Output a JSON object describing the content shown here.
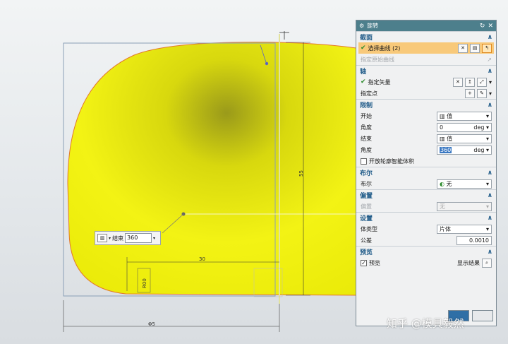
{
  "dialog": {
    "title": "旋转",
    "section_profile": {
      "title": "截面",
      "select_curve": "选择曲线 (2)",
      "specify_origin_curve": "指定原始曲线"
    },
    "section_axis": {
      "title": "轴",
      "specify_vector": "指定矢量",
      "specify_point": "指定点"
    },
    "section_limits": {
      "title": "限制",
      "start_label": "开始",
      "start_value": "值",
      "angle1_label": "角度",
      "angle1_value": "0",
      "angle1_unit": "deg",
      "end_label": "结束",
      "end_value": "值",
      "angle2_label": "角度",
      "angle2_value": "360",
      "angle2_unit": "deg",
      "open_profile_label": "开放轮廓智能体积"
    },
    "section_boolean": {
      "title": "布尔",
      "label": "布尔",
      "value": "无"
    },
    "section_offset": {
      "title": "偏置",
      "label": "偏置",
      "value": "无"
    },
    "section_settings": {
      "title": "设置",
      "body_type_label": "体类型",
      "body_type_value": "片体",
      "tolerance_label": "公差",
      "tolerance_value": "0.0010"
    },
    "section_preview": {
      "title": "预览",
      "preview_label": "预览",
      "show_result_label": "显示结果"
    }
  },
  "float_input": {
    "label": "结束",
    "value": "360"
  },
  "dimensions": {
    "d_horizontal": "30",
    "d_vertical": "55",
    "d_small": "R00",
    "d_bottom": "Φ5"
  },
  "watermark": {
    "text": "知乎 @模具毅然"
  },
  "colors": {
    "title_bar": "#4d7f8c",
    "section_header": "#225d8a",
    "highlight_row": "#f8c97a",
    "body_yellow": "#ecec14"
  }
}
